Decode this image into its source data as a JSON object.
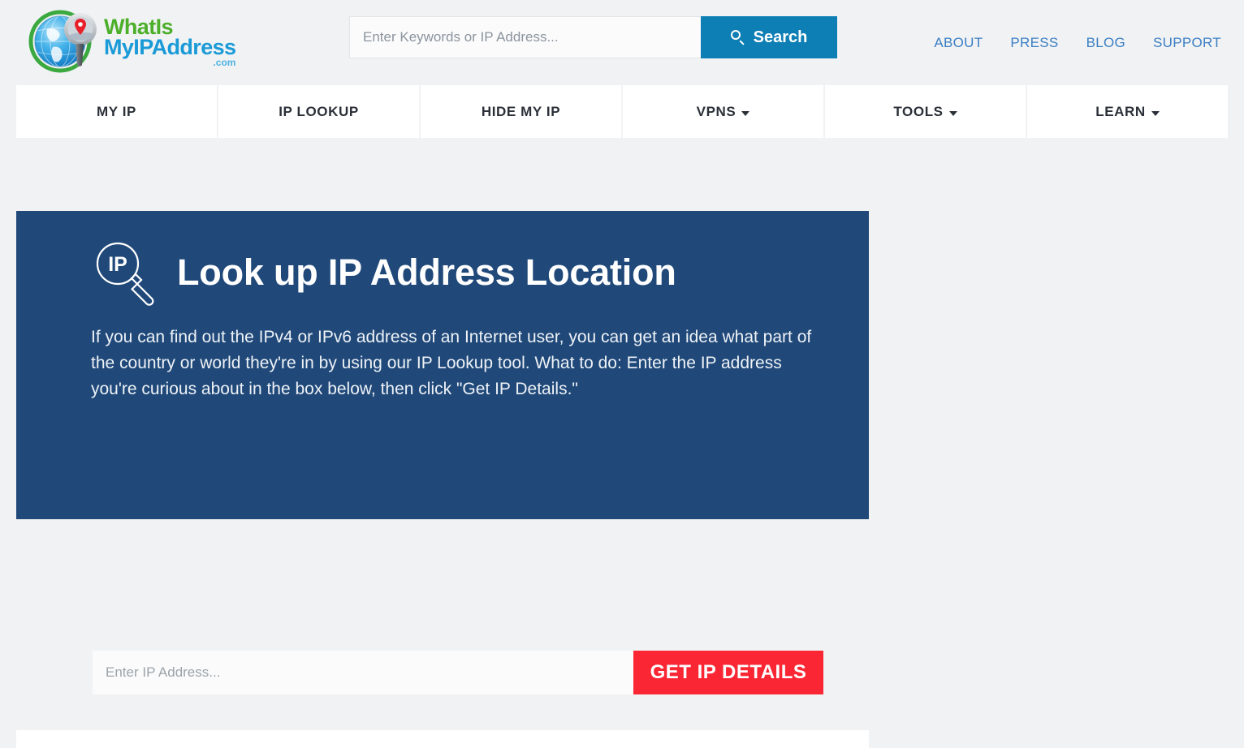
{
  "header": {
    "logo": {
      "line1": "WhatIs",
      "line2": "MyIPAddress",
      "dotcom": ".com",
      "mark_icon": "globe-magnifier-icon",
      "colors": {
        "line1": "#4caf2a",
        "line2": "#1a9ad6",
        "dotcom": "#4eb3e0"
      }
    },
    "search": {
      "placeholder": "Enter Keywords or IP Address...",
      "value": "",
      "button_label": "Search",
      "button_icon": "search-icon",
      "button_color": "#0e7fb5"
    },
    "top_nav": [
      {
        "label": "ABOUT"
      },
      {
        "label": "PRESS"
      },
      {
        "label": "BLOG"
      },
      {
        "label": "SUPPORT"
      }
    ],
    "top_nav_color": "#3b7fc4"
  },
  "main_nav": [
    {
      "label": "MY IP",
      "has_dropdown": false
    },
    {
      "label": "IP LOOKUP",
      "has_dropdown": false
    },
    {
      "label": "HIDE MY IP",
      "has_dropdown": false
    },
    {
      "label": "VPNS",
      "has_dropdown": true,
      "icon": "chevron-down-icon"
    },
    {
      "label": "TOOLS",
      "has_dropdown": true,
      "icon": "chevron-down-icon"
    },
    {
      "label": "LEARN",
      "has_dropdown": true,
      "icon": "chevron-down-icon"
    }
  ],
  "panel": {
    "background_color": "#20497a",
    "icon": "magnifier-ip-icon",
    "icon_label": "IP",
    "title": "Look up IP Address Location",
    "body": "If you can find out the IPv4 or IPv6 address of an Internet user, you can get an idea what part of the country or world they're in by using our IP Lookup tool. What to do: Enter the IP address you're curious about in the box below, then click \"Get IP Details.\"",
    "form": {
      "placeholder": "Enter IP Address...",
      "value": "",
      "button_label": "GET IP DETAILS",
      "button_color": "#fa2633"
    }
  }
}
